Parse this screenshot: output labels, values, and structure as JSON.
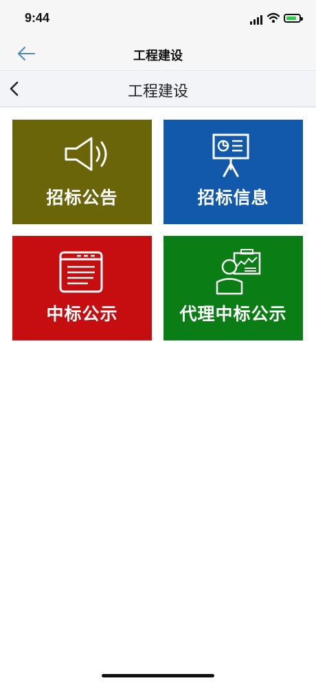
{
  "status_bar": {
    "time": "9:44"
  },
  "app_header": {
    "title": "工程建设"
  },
  "page_header": {
    "title": "工程建设"
  },
  "tiles": [
    {
      "label": "招标公告",
      "color": "#6a6508",
      "icon": "speaker-icon"
    },
    {
      "label": "招标信息",
      "color": "#1259ab",
      "icon": "presentation-board-icon"
    },
    {
      "label": "中标公示",
      "color": "#c60d0f",
      "icon": "document-window-icon"
    },
    {
      "label": "代理中标公示",
      "color": "#0a7d15",
      "icon": "person-chart-icon"
    }
  ]
}
